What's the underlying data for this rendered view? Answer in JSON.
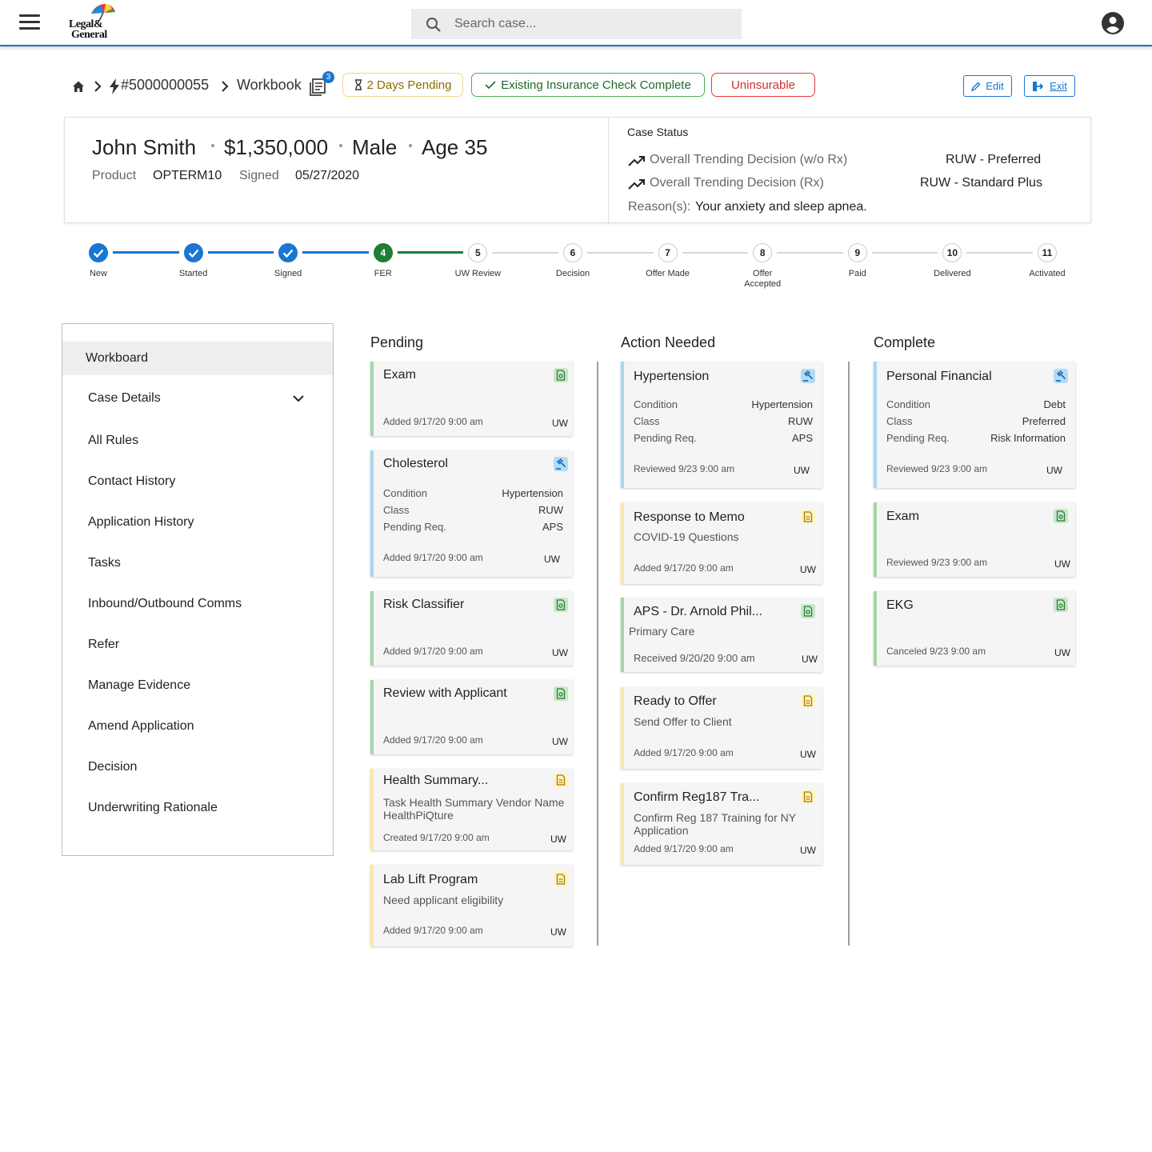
{
  "app": {
    "logo_line1": "Legal&",
    "logo_line2": "General",
    "search_placeholder": "Search case..."
  },
  "breadcrumb": {
    "case_id": "#5000000055",
    "page": "Workbook",
    "badge_count": "3"
  },
  "chips": {
    "pending": "2 Days Pending",
    "check": "Existing Insurance Check Complete",
    "uninsurable": "Uninsurable"
  },
  "actions": {
    "edit": "Edit",
    "exit": "Exit"
  },
  "summary": {
    "name": "John Smith",
    "amount": "$1,350,000",
    "gender": "Male",
    "age": "Age 35",
    "product_label": "Product",
    "product_value": "OPTERM10",
    "signed_label": "Signed",
    "signed_value": "05/27/2020"
  },
  "case_status": {
    "title": "Case Status",
    "row1_label": "Overall Trending Decision (w/o Rx)",
    "row1_value": "RUW - Preferred",
    "row2_label": "Overall Trending Decision (Rx)",
    "row2_value": "RUW - Standard Plus",
    "reason_label": "Reason(s):",
    "reason_value": "Your anxiety and sleep apnea."
  },
  "stepper": {
    "current": 4,
    "steps": [
      {
        "num": "1",
        "label": "New"
      },
      {
        "num": "2",
        "label": "Started"
      },
      {
        "num": "3",
        "label": "Signed"
      },
      {
        "num": "4",
        "label": "FER"
      },
      {
        "num": "5",
        "label": "UW Review"
      },
      {
        "num": "6",
        "label": "Decision"
      },
      {
        "num": "7",
        "label": "Offer Made"
      },
      {
        "num": "8",
        "label": "Offer Accepted"
      },
      {
        "num": "9",
        "label": "Paid"
      },
      {
        "num": "10",
        "label": "Delivered"
      },
      {
        "num": "11",
        "label": "Activated"
      }
    ]
  },
  "sidebar": {
    "items": [
      "Workboard",
      "Case Details",
      "All Rules",
      "Contact History",
      "Application History",
      "Tasks",
      "Inbound/Outbound Comms",
      "Refer",
      "Manage Evidence",
      "Amend Application",
      "Decision",
      "Underwriting Rationale"
    ]
  },
  "columns": {
    "pending": "Pending",
    "action": "Action Needed",
    "complete": "Complete"
  },
  "rule_labels": {
    "condition": "Condition",
    "class": "Class",
    "pending": "Pending Req."
  },
  "cards": {
    "p1": {
      "title": "Exam",
      "footer": "Added 9/17/20 9:00 am",
      "tag": "UW"
    },
    "p2": {
      "title": "Cholesterol",
      "cond": "Hypertension",
      "cls": "RUW",
      "req": "APS",
      "footer": "Added 9/17/20 9:00 am",
      "tag": "UW"
    },
    "p3": {
      "title": "Risk Classifier",
      "footer": "Added 9/17/20 9:00 am",
      "tag": "UW"
    },
    "p4": {
      "title": "Review with Applicant",
      "footer": "Added 9/17/20 9:00 am",
      "tag": "UW"
    },
    "p5": {
      "title": "Health Summary...",
      "sub": "Task Health Summary Vendor Name HealthPiQture",
      "footer": "Created 9/17/20 9:00 am",
      "tag": "UW"
    },
    "p6": {
      "title": "Lab Lift Program",
      "sub": "Need applicant eligibility",
      "footer": "Added 9/17/20 9:00 am",
      "tag": "UW"
    },
    "a1": {
      "title": "Hypertension",
      "cond": "Hypertension",
      "cls": "RUW",
      "req": "APS",
      "footer": "Reviewed 9/23 9:00 am",
      "tag": "UW"
    },
    "a2": {
      "title": "Response to Memo",
      "sub": "COVID-19 Questions",
      "footer": "Added 9/17/20 9:00 am",
      "tag": "UW"
    },
    "a3": {
      "title": "APS - Dr. Arnold Phil...",
      "sub": "Primary Care",
      "footer": "Received 9/20/20 9:00 am",
      "tag": "UW"
    },
    "a4": {
      "title": "Ready to Offer",
      "sub": "Send Offer to Client",
      "footer": "Added 9/17/20 9:00 am",
      "tag": "UW"
    },
    "a5": {
      "title": "Confirm Reg187 Tra...",
      "sub": "Confirm Reg 187 Training for NY Application",
      "footer": "Added 9/17/20 9:00 am",
      "tag": "UW"
    },
    "c1": {
      "title": "Personal Financial",
      "cond": "Debt",
      "cls": "Preferred",
      "req": "Risk Information",
      "footer": "Reviewed 9/23 9:00 am",
      "tag": "UW"
    },
    "c2": {
      "title": "Exam",
      "footer": "Reviewed 9/23 9:00 am",
      "tag": "UW"
    },
    "c3": {
      "title": "EKG",
      "footer": "Canceled 9/23 9:00 am",
      "tag": "UW"
    }
  },
  "colors": {
    "primary": "#1976d2",
    "success": "#1e7e34",
    "pending_chip": "#8a6d00",
    "danger": "#d32f2f",
    "green_bar": "#a5d6a7",
    "yellow_bar": "#ffe8a3",
    "blue_bar": "#a9d6ef"
  }
}
